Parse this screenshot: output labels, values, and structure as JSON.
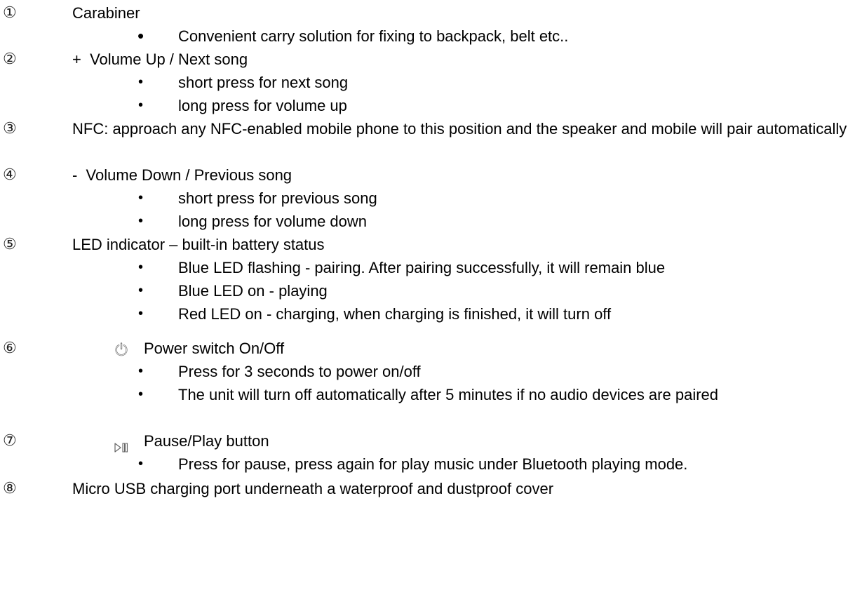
{
  "items": [
    {
      "number": "①",
      "title": "Carabiner",
      "bullets": [
        "Convenient carry solution for fixing to backpack, belt etc.."
      ]
    },
    {
      "number": "②",
      "title": "+  Volume Up / Next song",
      "bullets": [
        "short press for next song",
        "long press for volume up"
      ]
    },
    {
      "number": "③",
      "title": "NFC: approach any NFC-enabled mobile phone to this position and the speaker and mobile will pair automatically"
    },
    {
      "number": "④",
      "title": "-  Volume Down / Previous song",
      "bullets": [
        "short press for previous song",
        "long press for volume down"
      ]
    },
    {
      "number": "⑤",
      "title": "LED indicator – built-in battery status",
      "bullets": [
        "Blue LED flashing - pairing. After pairing successfully, it will remain blue",
        "Blue LED on - playing",
        "Red LED on - charging, when charging is finished, it will turn off"
      ]
    },
    {
      "number": "⑥",
      "icon": "power-icon",
      "title": "Power switch On/Off",
      "bullets": [
        "Press for 3 seconds to power on/off",
        "The unit will turn off automatically after 5 minutes if no audio devices are paired"
      ]
    },
    {
      "number": "⑦",
      "icon": "play-pause-icon",
      "title": "Pause/Play button",
      "bullets": [
        "Press for pause, press again for play music under Bluetooth playing mode."
      ]
    },
    {
      "number": "⑧",
      "title": "Micro USB charging port underneath a waterproof and dustproof cover"
    }
  ],
  "bullet_glyph": "•"
}
